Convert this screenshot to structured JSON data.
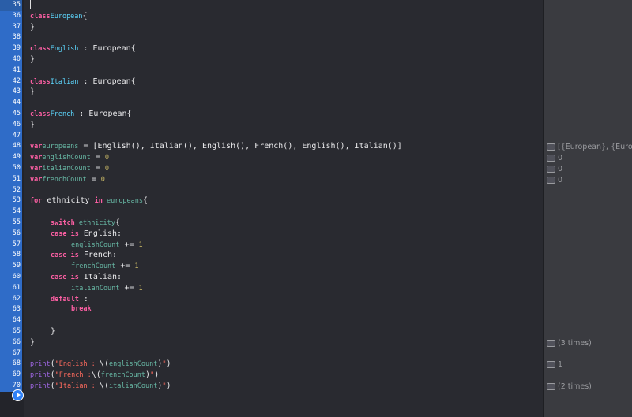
{
  "gutter": {
    "line_numbers": [
      "35",
      "36",
      "37",
      "38",
      "39",
      "40",
      "41",
      "42",
      "43",
      "44",
      "45",
      "46",
      "47",
      "48",
      "49",
      "50",
      "51",
      "52",
      "53",
      "54",
      "55",
      "56",
      "57",
      "58",
      "59",
      "60",
      "61",
      "62",
      "63",
      "64",
      "65",
      "66",
      "67",
      "68",
      "69",
      "70"
    ]
  },
  "code": {
    "l36": {
      "kw": "class",
      "type": "European",
      "rest": "{"
    },
    "l37": "}",
    "l39": {
      "kw": "class",
      "type": "English",
      "rest": " : European{"
    },
    "l40": "}",
    "l42": {
      "kw": "class",
      "type": "Italian",
      "rest": " : European{"
    },
    "l43": "}",
    "l45": {
      "kw": "class",
      "type": "French",
      "rest": " : European{"
    },
    "l46": "}",
    "l48": {
      "kw": "var",
      "id": "europeans",
      "rest": " = [English(), Italian(), English(), French(), English(), Italian()]"
    },
    "l49": {
      "kw": "var",
      "id": "englishCount",
      "op": " = ",
      "num": "0"
    },
    "l50": {
      "kw": "var",
      "id": "italianCount",
      "op": " = ",
      "num": "0"
    },
    "l51": {
      "kw": "var",
      "id": "frenchCount",
      "op": " = ",
      "num": "0"
    },
    "l53": {
      "kw": "for",
      "mid": " ethnicity ",
      "kw2": "in",
      "id": " europeans",
      "rest": "{"
    },
    "l55": {
      "kw": "switch",
      "id": " ethnicity",
      "rest": "{"
    },
    "l56": {
      "kw": "case",
      "kw2": " is",
      "rest": " English:"
    },
    "l57": {
      "id": "englishCount",
      "op": " += ",
      "num": "1"
    },
    "l58": {
      "kw": "case",
      "kw2": " is",
      "rest": " French:"
    },
    "l59": {
      "id": "frenchCount",
      "op": " += ",
      "num": "1"
    },
    "l60": {
      "kw": "case",
      "kw2": " is",
      "rest": " Italian:"
    },
    "l61": {
      "id": "italianCount",
      "op": " += ",
      "num": "1"
    },
    "l62": {
      "kw": "default",
      "rest": " :"
    },
    "l63": {
      "kw": "break"
    },
    "l65": "}",
    "l66": "}",
    "l68": {
      "fn": "print",
      "p1": "(",
      "s1": "\"English : ",
      "p2": "\\(",
      "id": "englishCount",
      "p3": ")",
      "s2": "\"",
      "p4": ")"
    },
    "l69": {
      "fn": "print",
      "p1": "(",
      "s1": "\"French :",
      "p2": "\\(",
      "id": "frenchCount",
      "p3": ")",
      "s2": "\"",
      "p4": ")"
    },
    "l70": {
      "fn": "print",
      "p1": "(",
      "s1": "\"Italian : ",
      "p2": "\\(",
      "id": "italianCount",
      "p3": ")",
      "s2": "\"",
      "p4": ")"
    }
  },
  "results": {
    "r48": "[{European}, {Euro...",
    "r49": "0",
    "r50": "0",
    "r51": "0",
    "r66": "(3 times)",
    "r68": "1",
    "r70": "(2 times)"
  },
  "colors": {
    "background": "#292a30",
    "keyword": "#fc5fa3",
    "type": "#5dd8ff",
    "identifier": "#67b7a4",
    "number": "#d0bf69",
    "string": "#fc6a5d",
    "gutter_highlight": "#2f6cc8"
  },
  "icons": {
    "run": "play-circle-icon",
    "result": "quicklook-icon"
  }
}
